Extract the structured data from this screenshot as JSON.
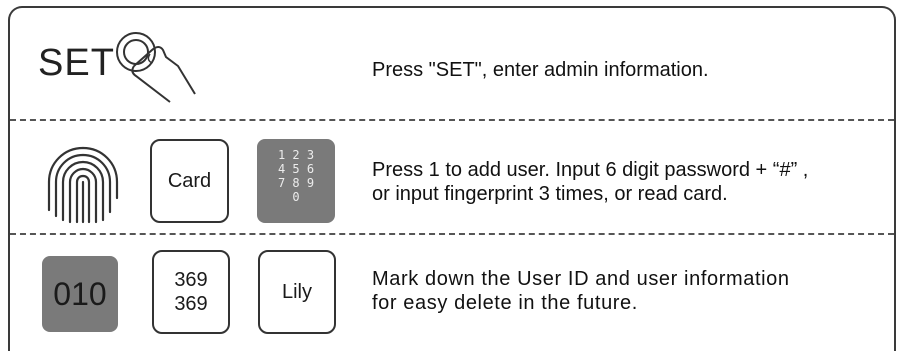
{
  "step1": {
    "set_label": "SET",
    "instruction": "Press \"SET\", enter admin information."
  },
  "step2": {
    "card_label": "Card",
    "keypad_rows": [
      "1 2 3",
      "4 5 6",
      "7 8 9",
      "0"
    ],
    "instruction_line1": "Press 1 to add user. Input 6 digit password + “#” ,",
    "instruction_line2": "or input fingerprint 3 times, or read card."
  },
  "step3": {
    "user_id": "010",
    "password_line1": "369",
    "password_line2": "369",
    "user_name": "Lily",
    "instruction_line1": "Mark down the User ID and user information",
    "instruction_line2": "for easy delete in the future."
  },
  "colors": {
    "gray_fill": "#7a7a7a",
    "border": "#3a3a3a"
  },
  "icons": [
    "finger-press-icon",
    "fingerprint-icon"
  ]
}
